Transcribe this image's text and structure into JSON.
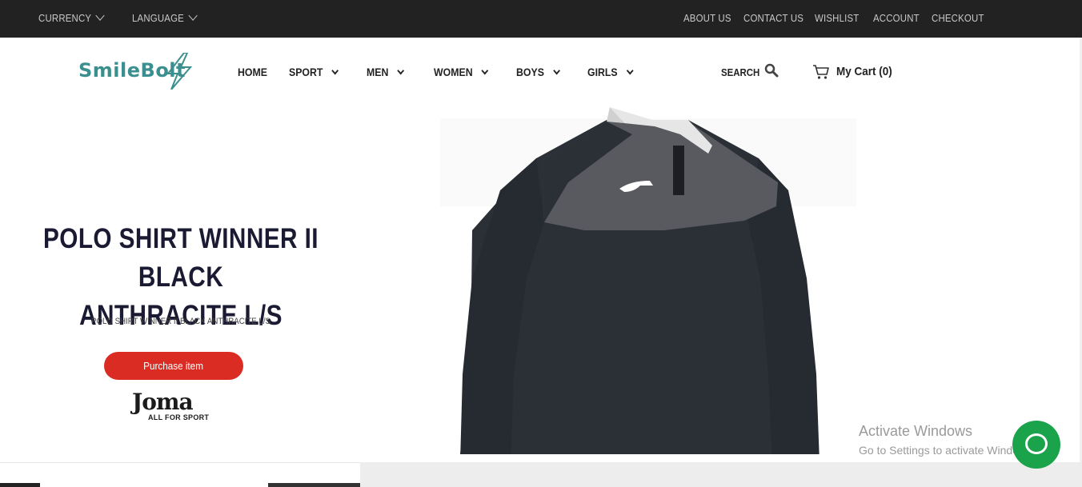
{
  "topbar": {
    "currency": "CURRENCY",
    "language": "LANGUAGE",
    "links": [
      "ABOUT US",
      "CONTACT US",
      "WISHLIST",
      "ACCOUNT",
      "CHECKOUT"
    ]
  },
  "header": {
    "logo_text": "SmileBolt",
    "nav": [
      {
        "label": "HOME",
        "dropdown": false
      },
      {
        "label": "SPORT",
        "dropdown": true
      },
      {
        "label": "MEN",
        "dropdown": true
      },
      {
        "label": "WOMEN",
        "dropdown": true
      },
      {
        "label": "BOYS",
        "dropdown": true
      },
      {
        "label": "GIRLS",
        "dropdown": true
      }
    ],
    "search_label": "SEARCH",
    "cart_label": "My Cart (0)"
  },
  "hero": {
    "title_line1": "POLO SHIRT WINNER II BLACK",
    "title_line2": "ANTHRACITE L/S",
    "subtitle": "POLO SHIRT WINNER II BLACK ANTHRACITE L/S",
    "purchase_label": "Purchase item",
    "brand_name": "Joma",
    "brand_tagline": "ALL FOR SPORT"
  },
  "watermark": {
    "title": "Activate Windows",
    "subtitle": "Go to Settings to activate Windows."
  },
  "colors": {
    "topbar_bg": "#222222",
    "brand_teal": "#3b8f8f",
    "purchase_red": "#db2c23",
    "chat_green": "#1aa34a"
  },
  "icons": {
    "search": "search-icon",
    "cart": "cart-icon",
    "chat": "chat-icon",
    "dropdown": "chevron-down-icon"
  }
}
